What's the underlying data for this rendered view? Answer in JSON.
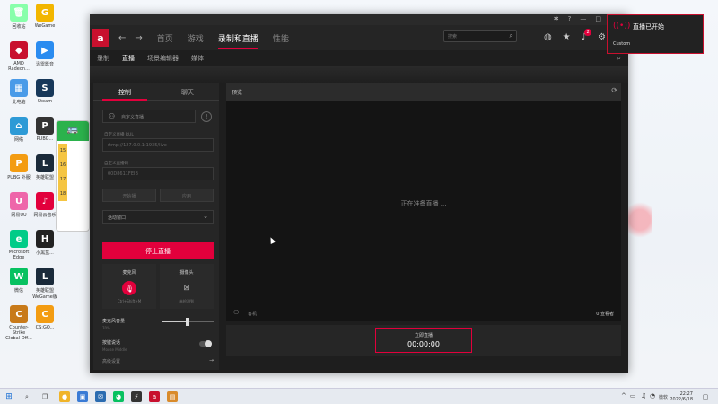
{
  "desktop": {
    "icons": [
      {
        "label": "回收站",
        "glyph": "🗑",
        "color": "#8fa"
      },
      {
        "label": "WeGame",
        "glyph": "G",
        "color": "#f2b600"
      },
      {
        "label": "AMD Radeon...",
        "glyph": "◆",
        "color": "#c8102e"
      },
      {
        "label": "迅雷影音",
        "glyph": "▶",
        "color": "#2a8cf0"
      },
      {
        "label": "此电脑",
        "glyph": "▦",
        "color": "#4a9be8"
      },
      {
        "label": "Steam",
        "glyph": "S",
        "color": "#17385a"
      },
      {
        "label": "网络",
        "glyph": "⌂",
        "color": "#2d9ad6"
      },
      {
        "label": "PUBG...",
        "glyph": "P",
        "color": "#333"
      },
      {
        "label": "PUBG 外服",
        "glyph": "P",
        "color": "#f39c12"
      },
      {
        "label": "英雄联盟",
        "glyph": "L",
        "color": "#1a2a3a"
      },
      {
        "label": "网易UU",
        "glyph": "U",
        "color": "#e6a"
      },
      {
        "label": "网易云音乐",
        "glyph": "♪",
        "color": "#e2003c"
      },
      {
        "label": "Microsoft Edge",
        "glyph": "e",
        "color": "#0c8"
      },
      {
        "label": "小黑盒...",
        "glyph": "H",
        "color": "#222"
      },
      {
        "label": "微信",
        "glyph": "W",
        "color": "#07c160"
      },
      {
        "label": "英雄联盟WeGame版",
        "glyph": "L",
        "color": "#1a2a3a"
      },
      {
        "label": "Counter-Strike Global Off...",
        "glyph": "C",
        "color": "#c87a1a"
      },
      {
        "label": "CS:GO...",
        "glyph": "C",
        "color": "#f39c12"
      }
    ]
  },
  "app": {
    "logo": "a",
    "nav": {
      "back": "←",
      "forward": "→",
      "items": [
        "首页",
        "游戏",
        "录制和直播",
        "性能"
      ],
      "active_index": 2
    },
    "search_placeholder": "搜索",
    "notification_count": "2",
    "subnav": {
      "items": [
        "录制",
        "直播",
        "场景编辑器",
        "媒体"
      ],
      "active_index": 1
    },
    "left_panel": {
      "tabs": [
        "控制",
        "聊天"
      ],
      "active_tab": 0,
      "custom_live_placeholder": "自定义直播",
      "url_label": "自定义直播 RUL",
      "url_value": "rtmp://127.0.0.1:1935/live",
      "key_label": "自定义直播码",
      "key_value": "00D8611FEIB",
      "btn_start": "开始播",
      "btn_apply": "应用",
      "source": "活动窗口",
      "stop_button": "停止直播",
      "mic": {
        "title": "麦克风",
        "hint": "Ctrl+Shift+M"
      },
      "camera": {
        "title": "摄像头",
        "hint": "未检测到"
      },
      "mic_volume": {
        "title": "麦克风音量",
        "value": "70%",
        "level": 0.5
      },
      "hotkey": {
        "title": "按键说话",
        "sub": "Mouse Middle"
      },
      "advanced": "高级设置"
    },
    "preview": {
      "title": "预览",
      "preparing": "正在准备直播 ...",
      "guest_label": "客机",
      "viewers": "0 查看者"
    },
    "go_live": {
      "label": "立即直播",
      "timer": "00:00:00"
    }
  },
  "toast": {
    "title": "直播已开始",
    "subtitle": "Custom"
  },
  "taskbar": {
    "time": "22:27",
    "date": "2022/6/18",
    "ime": "微软"
  }
}
